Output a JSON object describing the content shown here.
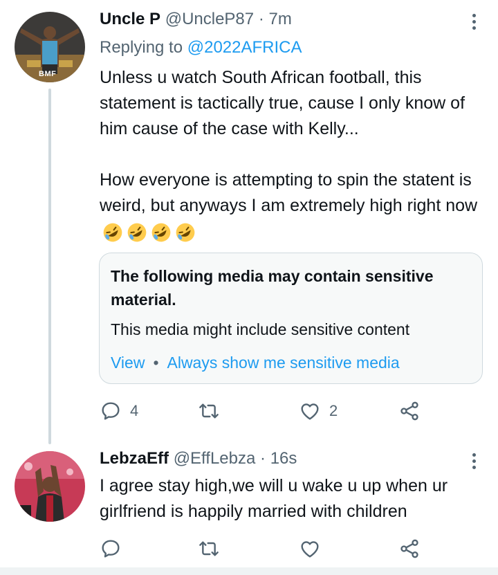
{
  "tweet1": {
    "name": "Uncle P",
    "handle": "@UncleP87",
    "dot": "·",
    "time": "7m",
    "avatar_label": "BMF",
    "replying_prefix": "Replying to",
    "replying_handle": "@2022AFRICA",
    "text_p1": "Unless u watch South African football, this statement is tactically true, cause I only know of him cause of the case with Kelly...",
    "text_p2": "How everyone is attempting to spin the statent is weird, but anyways I am extremely high right now",
    "emojis": [
      "rolling-on-floor-laughing",
      "rolling-on-floor-laughing",
      "rolling-on-floor-laughing",
      "rolling-on-floor-laughing"
    ],
    "media_warning": {
      "title": "The following media may contain sensitive material.",
      "description": "This media might include sensitive content",
      "view_label": "View",
      "separator": "•",
      "always_show_label": "Always show me sensitive media"
    },
    "stats": {
      "replies": "4",
      "retweets": "",
      "likes": "2"
    }
  },
  "tweet2": {
    "name": "LebzaEff",
    "handle": "@EffLebza",
    "dot": "·",
    "time": "16s",
    "text": "I agree stay high,we will u wake u up when ur girlfriend is happily married with children",
    "stats": {
      "replies": "",
      "retweets": "",
      "likes": ""
    }
  },
  "colors": {
    "link": "#1d9bf0",
    "secondary_text": "#536471",
    "thread_line": "#cfd9de"
  }
}
